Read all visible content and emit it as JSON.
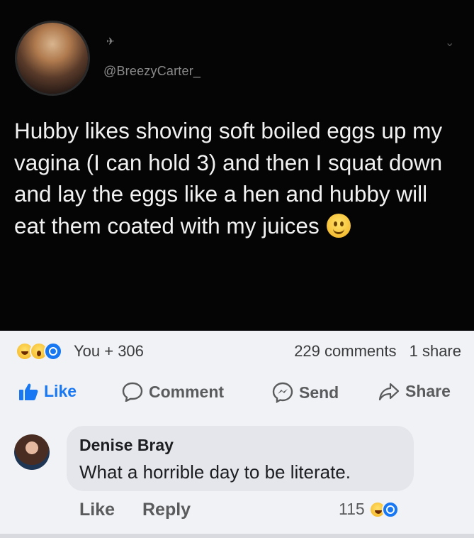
{
  "tweet": {
    "handle": "@BreezyCarter_",
    "text": "Hubby likes shoving soft boiled eggs up my vagina (I can hold 3) and then I squat down and lay the eggs like a hen and hubby will eat them coated with my juices",
    "avatar_icon": "profile-photo",
    "text_color": "#f1f1f1",
    "background": "#050505"
  },
  "post_stats": {
    "reaction_icons": [
      "haha-reaction-icon",
      "wow-reaction-icon",
      "like-reaction-icon"
    ],
    "reactions_text": "You + 306",
    "comments": "229 comments",
    "shares": "1 share"
  },
  "actions": {
    "like": "Like",
    "comment": "Comment",
    "send": "Send",
    "share": "Share",
    "like_color": "#1877f2"
  },
  "comment": {
    "author": "Denise Bray",
    "text": "What a horrible day to be literate.",
    "like_label": "Like",
    "reply_label": "Reply",
    "reaction_count": "115"
  }
}
